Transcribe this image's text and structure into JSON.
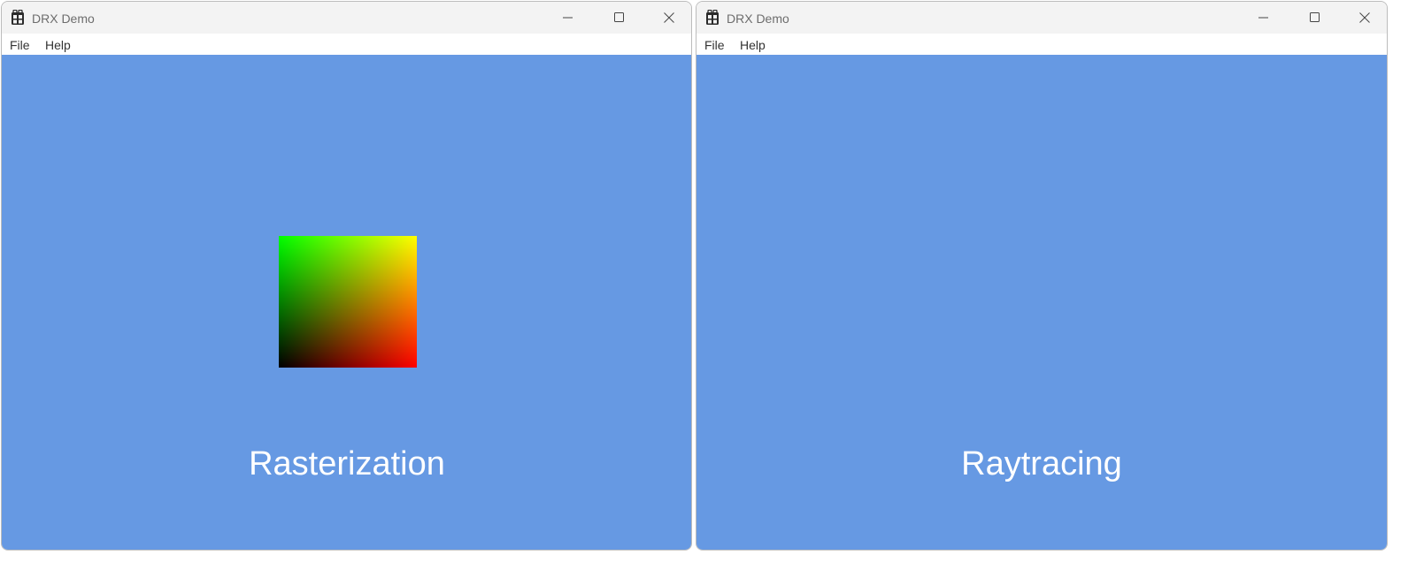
{
  "windows": [
    {
      "title": "DRX Demo",
      "menu": {
        "file": "File",
        "help": "Help"
      },
      "label": "Rasterization"
    },
    {
      "title": "DRX Demo",
      "menu": {
        "file": "File",
        "help": "Help"
      },
      "label": "Raytracing"
    }
  ],
  "colors": {
    "viewport_background": "#6699e3",
    "gradient_top_left": "#00ff00",
    "gradient_top_right": "#ffff00",
    "gradient_bottom_left": "#000000",
    "gradient_bottom_right": "#ff0000"
  },
  "icons": [
    "app-icon",
    "minimize-icon",
    "maximize-icon",
    "close-icon"
  ]
}
